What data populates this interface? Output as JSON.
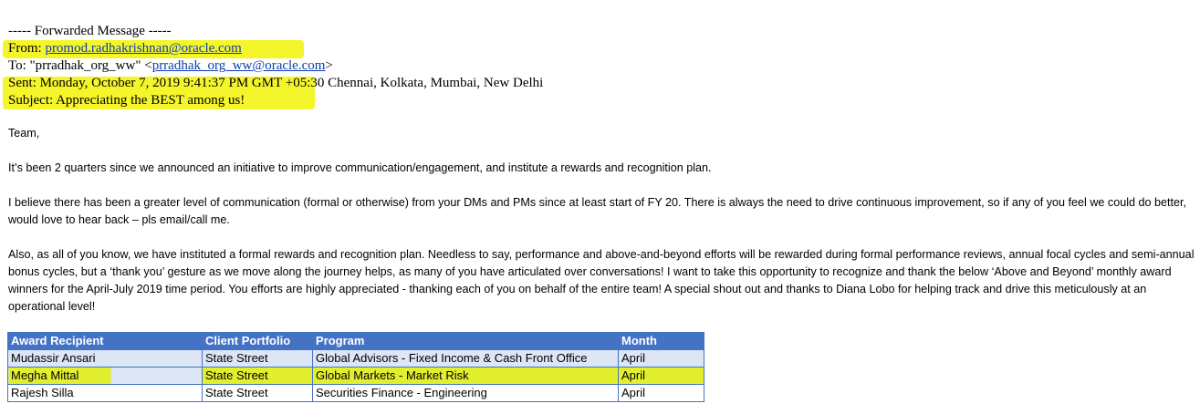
{
  "header": {
    "forwarded": "----- Forwarded Message -----",
    "from_label": "From: ",
    "from_email": "promod.radhakrishnan@oracle.com",
    "to_prefix": "To: \"prradhak_org_ww\" <",
    "to_email": "prradhak_org_ww@oracle.com",
    "to_suffix": ">",
    "sent": "Sent: Monday, October 7, 2019 9:41:37 PM GMT +05:30 Chennai, Kolkata, Mumbai, New Delhi",
    "subject": "Subject: Appreciating the BEST among us!"
  },
  "body": {
    "greeting": "Team,",
    "p1": "It’s been 2 quarters since we announced an initiative to improve communication/engagement, and institute a rewards and recognition plan.",
    "p2": "I believe there has been a greater level of communication (formal or otherwise) from your DMs and PMs since at least start of FY 20. There is always the need to drive continuous improvement, so if any of you feel we could do better, would love to hear back – pls email/call me.",
    "p3": "Also, as all of you know, we have instituted a formal rewards and recognition plan. Needless to say, performance and above-and-beyond efforts will be rewarded during formal performance reviews, annual focal cycles and semi-annual bonus cycles, but a ‘thank you’ gesture as we move along the journey helps, as many of you have articulated over conversations! I want to take this opportunity to recognize and thank the below ‘Above and Beyond’ monthly award winners for the April-July 2019 time period. You efforts are highly appreciated - thanking each of you on behalf of the entire team! A special shout out and thanks to Diana Lobo for helping track and drive this meticulously at an operational level!"
  },
  "table": {
    "headers": [
      "Award Recipient",
      "Client Portfolio",
      "Program",
      "Month"
    ],
    "rows": [
      [
        "Mudassir Ansari",
        "State Street",
        "Global Advisors - Fixed Income & Cash Front Office",
        "April"
      ],
      [
        "Megha Mittal",
        "State Street",
        "Global Markets - Market Risk",
        "April"
      ],
      [
        "Rajesh Silla",
        "State Street",
        "Securities Finance  - Engineering",
        "April"
      ]
    ]
  },
  "colors": {
    "highlight": "#f4f52a",
    "table_header": "#4472c4",
    "row_alt": "#dce6f4",
    "link": "#0b3fb0"
  }
}
